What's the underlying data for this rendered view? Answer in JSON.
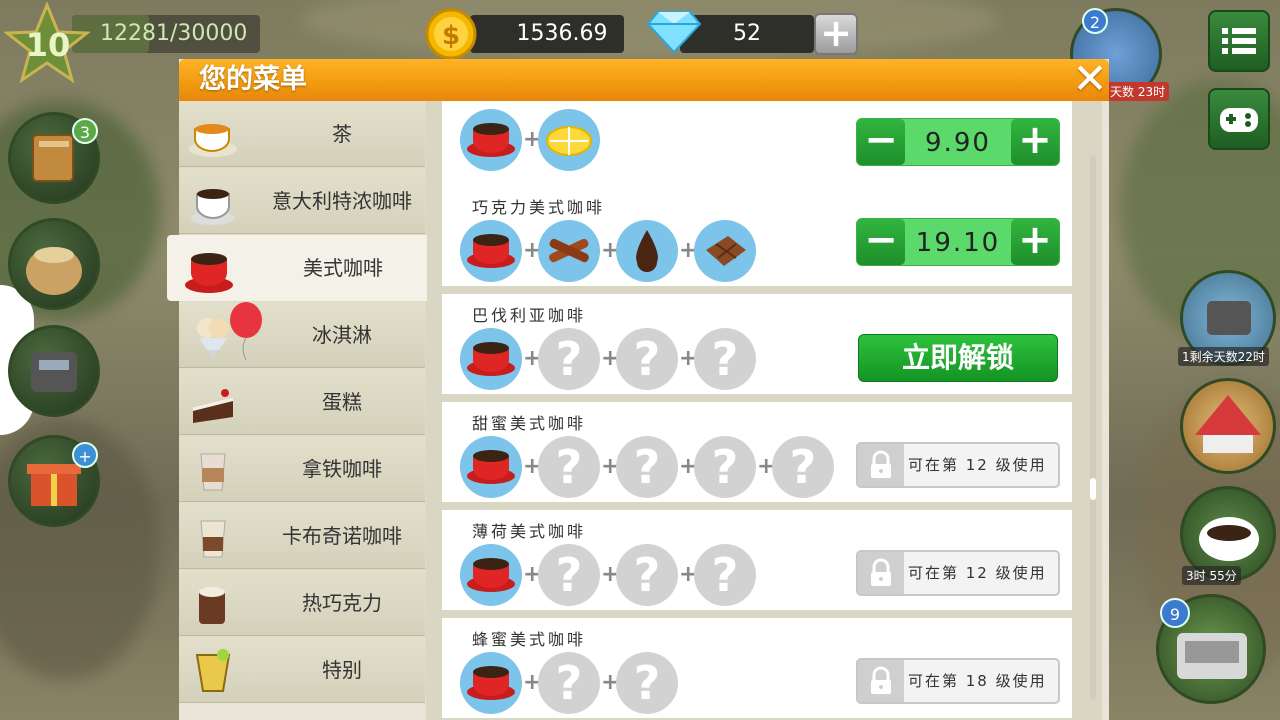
{
  "hud": {
    "level": "10",
    "xp": "12281/30000",
    "xp_fraction": 0.409,
    "coins": "1536.69",
    "gems": "52",
    "add_label": "+"
  },
  "side": {
    "book_badge": "3",
    "event_badge": "2",
    "event_timer": "天数 23时",
    "phone_timer": "1剩余天数22时",
    "coffee_timer": "3时 55分",
    "register_badge": "9",
    "gift_badge": "+"
  },
  "dialog": {
    "title": "您的菜单",
    "close": "✕"
  },
  "categories": [
    {
      "label": "茶",
      "icon": "tea-cup-icon"
    },
    {
      "label": "意大利特浓咖啡",
      "icon": "espresso-cup-icon"
    },
    {
      "label": "美式咖啡",
      "icon": "americano-cup-icon",
      "active": true
    },
    {
      "label": "冰淇淋",
      "icon": "ice-cream-icon"
    },
    {
      "label": "蛋糕",
      "icon": "cake-icon"
    },
    {
      "label": "拿铁咖啡",
      "icon": "latte-icon"
    },
    {
      "label": "卡布奇诺咖啡",
      "icon": "cappuccino-icon"
    },
    {
      "label": "热巧克力",
      "icon": "hot-chocolate-icon"
    },
    {
      "label": "特别",
      "icon": "special-drink-icon"
    }
  ],
  "items": [
    {
      "name": "",
      "price": "9.90",
      "ingredients": [
        "coffee",
        "lemon"
      ]
    },
    {
      "name": "巧克力美式咖啡",
      "price": "19.10",
      "ingredients": [
        "coffee",
        "cinnamon",
        "chocolate-syrup",
        "chocolate-bar"
      ]
    },
    {
      "name": "巴伐利亚咖啡",
      "action": "立即解锁",
      "ingredients": [
        "coffee",
        "?",
        "?",
        "?"
      ]
    },
    {
      "name": "甜蜜美式咖啡",
      "lock": "可在第 12 级使用",
      "ingredients": [
        "coffee",
        "?",
        "?",
        "?",
        "?"
      ]
    },
    {
      "name": "薄荷美式咖啡",
      "lock": "可在第 12 级使用",
      "ingredients": [
        "coffee",
        "?",
        "?",
        "?"
      ]
    },
    {
      "name": "蜂蜜美式咖啡",
      "lock": "可在第 18 级使用",
      "ingredients": [
        "coffee",
        "?",
        "?"
      ]
    }
  ],
  "labels": {
    "minus": "−",
    "plus": "+",
    "question": "?"
  }
}
